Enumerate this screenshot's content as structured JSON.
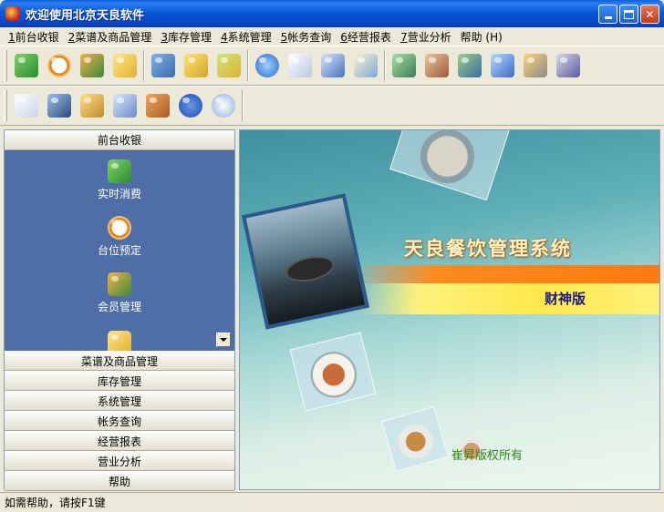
{
  "window": {
    "title": "欢迎使用北京天良软件"
  },
  "menu": [
    {
      "key": "1",
      "label": "前台收银"
    },
    {
      "key": "2",
      "label": "菜谱及商品管理"
    },
    {
      "key": "3",
      "label": "库存管理"
    },
    {
      "key": "4",
      "label": "系统管理"
    },
    {
      "key": "5",
      "label": "帐务查询"
    },
    {
      "key": "6",
      "label": "经营报表"
    },
    {
      "key": "7",
      "label": "营业分析"
    },
    {
      "key": "",
      "label": "帮助 (H)"
    }
  ],
  "toolbar1_icons": [
    "realtime-consume-icon",
    "clock-icon",
    "members-icon",
    "checklist-folder-icon",
    "books-icon",
    "folder-open-icon",
    "folder-arrow-icon",
    "globe-icon",
    "magnifier-doc-icon",
    "notebook-icon",
    "paper-arrow-icon",
    "monitor-icon",
    "bookshelf-icon",
    "network-user-icon",
    "computer-icon",
    "tools-icon",
    "printer-disk-icon"
  ],
  "toolbar2_icons": [
    "blank-page-icon",
    "user-phone-icon",
    "key-icon",
    "calculator-icon",
    "briefcase-icon",
    "help-icon",
    "info-icon"
  ],
  "colors": {
    "nav_blue": "#4f6ea6",
    "title_blue": "#0b58d6",
    "accent_orange": "#ff8a1e",
    "accent_yellow": "#ffe84a"
  },
  "leftnav": {
    "active_header": "前台收银",
    "entries": [
      {
        "icon": "realtime-consume-icon",
        "label": "实时消费"
      },
      {
        "icon": "clock-icon",
        "label": "台位预定"
      },
      {
        "icon": "members-icon",
        "label": "会员管理"
      },
      {
        "icon": "checklist-folder-icon",
        "label": ""
      }
    ],
    "sections": [
      "菜谱及商品管理",
      "库存管理",
      "系统管理",
      "帐务查询",
      "经营报表",
      "营业分析",
      "帮助"
    ]
  },
  "splash": {
    "system_title": "天良餐饮管理系统",
    "edition": "财神版",
    "copyright": "崔昇版权所有"
  },
  "status": {
    "text": "如需帮助，请按F1键"
  }
}
